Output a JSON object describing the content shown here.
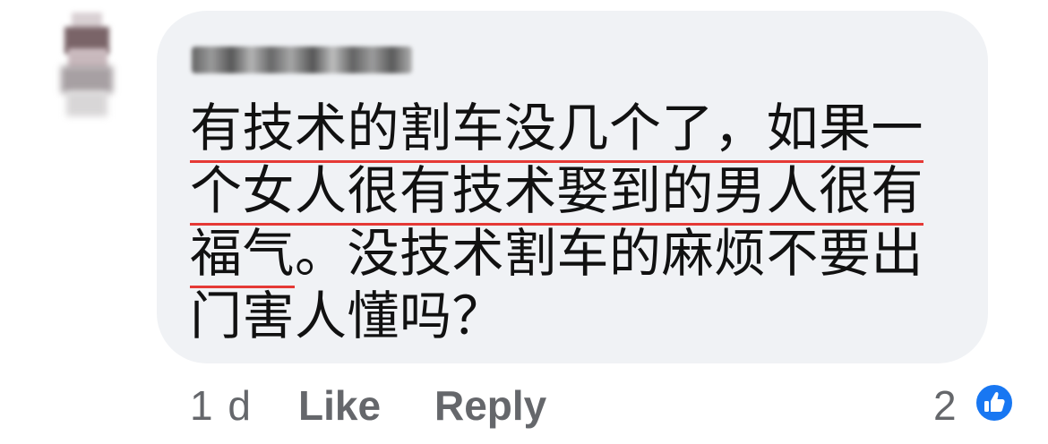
{
  "comment": {
    "author_name_obscured": "",
    "lines": [
      "有技术的割车没几个了，如果一",
      "个女人很有技术娶到的男人很有",
      "福气",
      "。没技术割车的麻烦不要出",
      "门害人懂吗？"
    ]
  },
  "actions": {
    "timestamp": "1 d",
    "like_label": "Like",
    "reply_label": "Reply",
    "reaction_count": "2",
    "reaction_icon": "thumbs-up-icon"
  },
  "colors": {
    "bubble_bg": "#f0f2f5",
    "underline": "#e53935",
    "action_text": "#65676b",
    "reaction_blue": "#1877f2"
  }
}
